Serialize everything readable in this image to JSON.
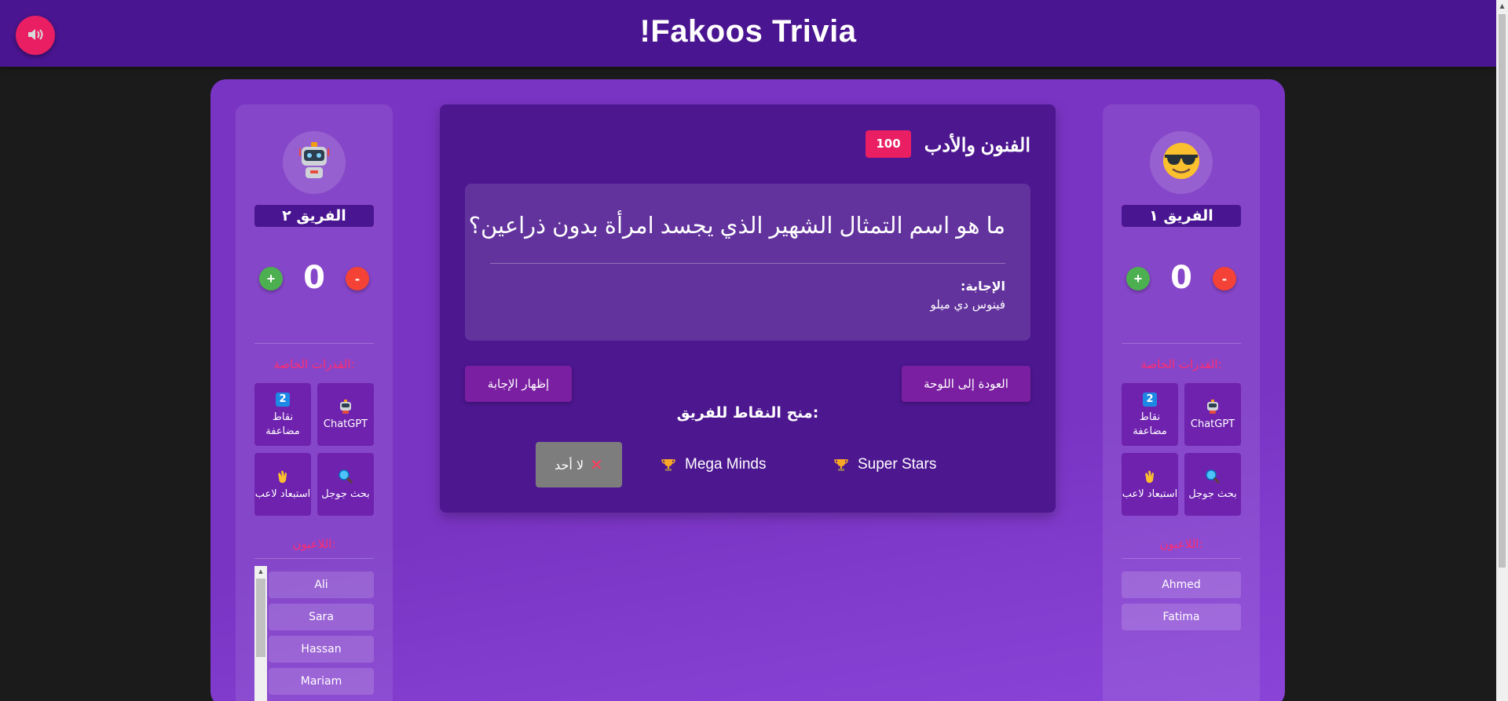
{
  "header": {
    "title": "!Fakoos Trivia",
    "sound_icon": "speaker-muted-icon"
  },
  "question": {
    "category": "الفنون والأدب",
    "points": "100",
    "text": "ما هو اسم التمثال الشهير الذي يجسد امرأة بدون ذراعين؟",
    "answer_label": "الإجابة:",
    "answer": "فينوس دي ميلو",
    "back_button": "العودة إلى اللوحة",
    "reveal_button": "إظهار الإجابة",
    "award_title": "منح النقاط للفريق:",
    "award_options": [
      "Super Stars",
      "Mega Minds"
    ],
    "award_none": "لا أحد",
    "award_none_icon": "cross-icon",
    "trophy_icon": "trophy-icon"
  },
  "teams": [
    {
      "name": "الفريق ١",
      "avatar_icon": "cool-face-icon",
      "score": "0",
      "plus": "+",
      "minus": "-",
      "abilities_title": "القدرات الخاصة:",
      "abilities": [
        {
          "label": "ChatGPT",
          "icon": "robot-icon"
        },
        {
          "label": "نقاط مضاعفة",
          "icon": "keycap-2-icon",
          "icon_text": "2"
        },
        {
          "label": "بحث جوجل",
          "icon": "magnifier-icon"
        },
        {
          "label": "استبعاد لاعب",
          "icon": "waving-hand-icon"
        }
      ],
      "players_title": "اللاعبون:",
      "players": [
        "Ahmed",
        "Fatima"
      ]
    },
    {
      "name": "الفريق ٢",
      "avatar_icon": "robot-icon",
      "score": "0",
      "plus": "+",
      "minus": "-",
      "abilities_title": "القدرات الخاصة:",
      "abilities": [
        {
          "label": "ChatGPT",
          "icon": "robot-icon"
        },
        {
          "label": "نقاط مضاعفة",
          "icon": "keycap-2-icon",
          "icon_text": "2"
        },
        {
          "label": "بحث جوجل",
          "icon": "magnifier-icon"
        },
        {
          "label": "استبعاد لاعب",
          "icon": "waving-hand-icon"
        }
      ],
      "players_title": "اللاعبون:",
      "players": [
        "Ali",
        "Sara",
        "Hassan",
        "Mariam"
      ]
    }
  ],
  "colors": {
    "header": "#4a1590",
    "board": "#7a34c4",
    "accent": "#e91e63",
    "plus": "#4caf50",
    "minus": "#f44336",
    "section_title": "#ff2d6f"
  }
}
